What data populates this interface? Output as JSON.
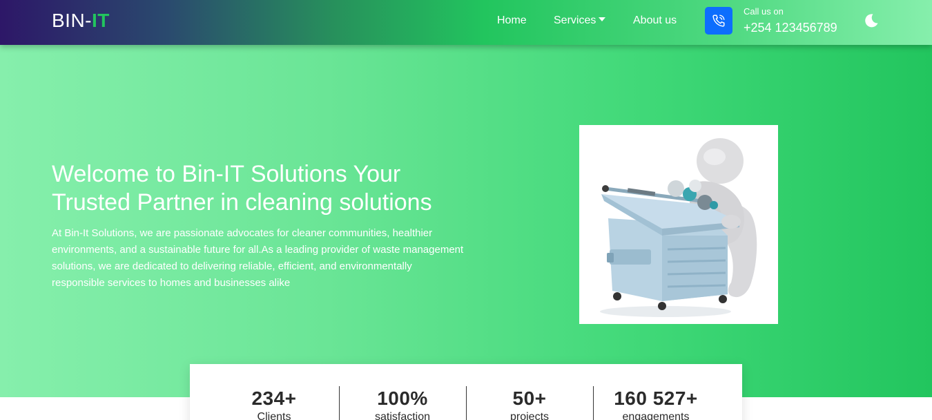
{
  "navbar": {
    "brand_prefix": "BIN-",
    "brand_suffix": "IT",
    "links": [
      {
        "label": "Home"
      },
      {
        "label": "Services"
      },
      {
        "label": "About us"
      }
    ],
    "call_label": "Call us on",
    "call_number": "+254 123456789",
    "phone_icon": "phone-call-icon",
    "theme_icon": "moon-icon"
  },
  "hero": {
    "title": "Welcome to Bin-IT Solutions Your Trusted Partner in cleaning solutions",
    "description": "At Bin-It Solutions, we are passionate advocates for cleaner communities, healthier environments, and a sustainable future for all.As a leading provider of waste management solutions, we are dedicated to delivering reliable, efficient, and environmentally responsible services to homes and businesses alike",
    "image": "3d-figure-with-dumpster-illustration"
  },
  "stats": [
    {
      "value": "234+",
      "label": "Clients"
    },
    {
      "value": "100%",
      "label": "satisfaction"
    },
    {
      "value": "50+",
      "label": "projects"
    },
    {
      "value": "160 527+",
      "label": "engagements"
    }
  ],
  "colors": {
    "accent_green": "#22c55e",
    "light_green": "#86efac",
    "nav_dark": "#2d1768",
    "phone_blue": "#0d6efd"
  }
}
